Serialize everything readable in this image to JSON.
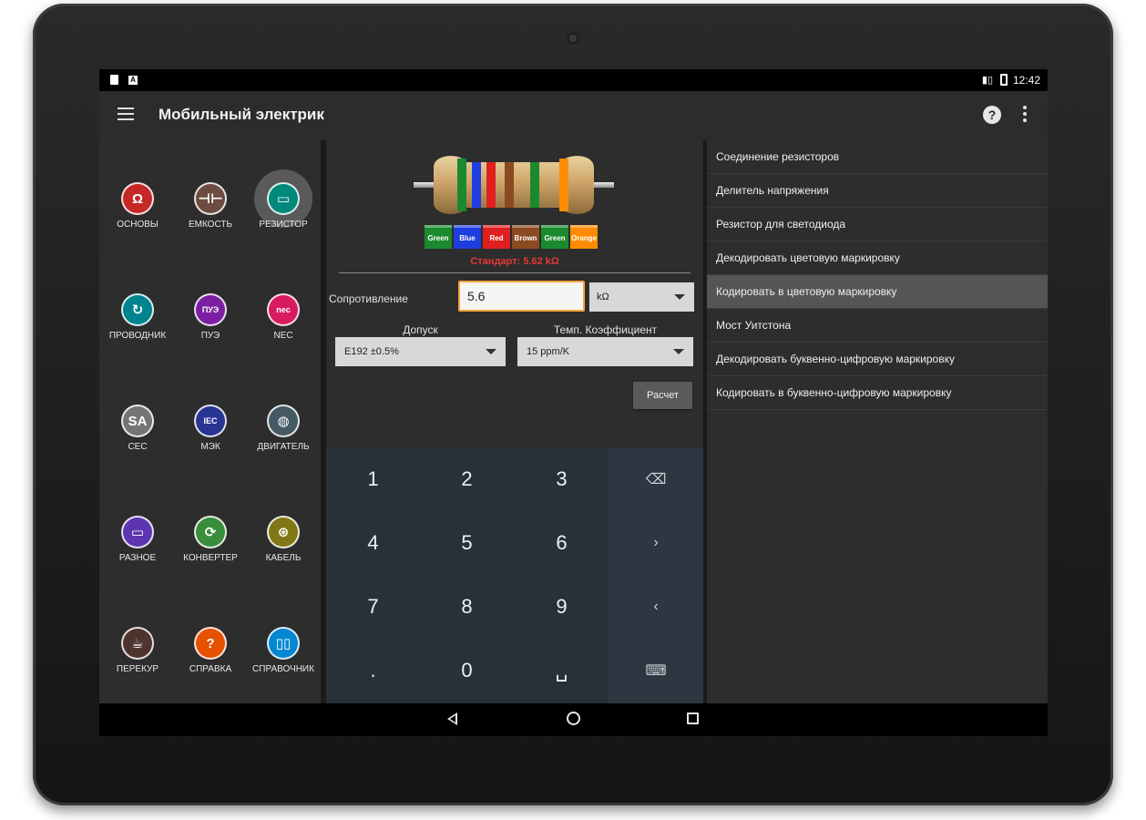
{
  "status_bar": {
    "time": "12:42"
  },
  "toolbar": {
    "title": "Мобильный электрик"
  },
  "left_grid": {
    "items": [
      {
        "label": "ОСНОВЫ",
        "glyph": "Ω",
        "color": "#c62828",
        "icon": "omega-icon"
      },
      {
        "label": "ЕМКОСТЬ",
        "glyph": "⊣⊢",
        "color": "#6d4c41",
        "icon": "capacitor-icon"
      },
      {
        "label": "РЕЗИСТОР",
        "glyph": "▭",
        "color": "#00897b",
        "icon": "resistor-icon"
      },
      {
        "label": "ПРОВОДНИК",
        "glyph": "↻",
        "color": "#00838f",
        "icon": "wire-icon"
      },
      {
        "label": "ПУЭ",
        "glyph": "ПУЭ",
        "color": "#7b1fa2",
        "icon": "pue-icon"
      },
      {
        "label": "NEC",
        "glyph": "nec",
        "color": "#d81b60",
        "icon": "nec-icon"
      },
      {
        "label": "CEC",
        "glyph": "SA",
        "color": "#757575",
        "icon": "cec-icon"
      },
      {
        "label": "МЭК",
        "glyph": "IEC",
        "color": "#283593",
        "icon": "iec-icon"
      },
      {
        "label": "ДВИГАТЕЛЬ",
        "glyph": "◍",
        "color": "#455a64",
        "icon": "motor-icon"
      },
      {
        "label": "РАЗНОЕ",
        "glyph": "▭",
        "color": "#5e35b1",
        "icon": "folder-icon"
      },
      {
        "label": "КОНВЕРТЕР",
        "glyph": "⟳",
        "color": "#388e3c",
        "icon": "converter-icon"
      },
      {
        "label": "КАБЕЛЬ",
        "glyph": "⊛",
        "color": "#827717",
        "icon": "cable-icon"
      },
      {
        "label": "ПЕРЕКУР",
        "glyph": "☕",
        "color": "#4e342e",
        "icon": "coffee-icon"
      },
      {
        "label": "СПРАВКА",
        "glyph": "?",
        "color": "#e65100",
        "icon": "help-circle-icon"
      },
      {
        "label": "СПРАВОЧНИК",
        "glyph": "▯▯",
        "color": "#0288d1",
        "icon": "book-icon"
      }
    ],
    "active_index": 2
  },
  "resistor": {
    "bands": [
      {
        "name": "Green",
        "color": "#1b8a2e"
      },
      {
        "name": "Blue",
        "color": "#1e3ee0"
      },
      {
        "name": "Red",
        "color": "#e02020"
      },
      {
        "name": "Brown",
        "color": "#8b4a22"
      },
      {
        "name": "Green",
        "color": "#1b8a2e"
      },
      {
        "name": "Orange",
        "color": "#ff8c00"
      }
    ],
    "standard_text": "Стандарт:  5.62 kΩ"
  },
  "form": {
    "resistance_label": "Сопротивление",
    "resistance_value": "5.6",
    "unit": "kΩ",
    "tolerance_label": "Допуск",
    "tolerance_value": "E192 ±0.5%",
    "tempco_label": "Темп. Коэффициент",
    "tempco_value": "15 ppm/K",
    "calc_button": "Расчет"
  },
  "keypad": {
    "keys": [
      "1",
      "2",
      "3",
      "4",
      "5",
      "6",
      "7",
      "8",
      "9",
      ".",
      "0",
      "␣"
    ],
    "fn_keys": [
      "⌫",
      "›",
      "‹",
      "⌨"
    ]
  },
  "right_menu": {
    "items": [
      "Соединение резисторов",
      "Делитель напряжения",
      "Резистор для светодиода",
      "Декодировать цветовую маркировку",
      "Кодировать в цветовую маркировку",
      "Мост Уитстона",
      "Декодировать буквенно-цифровую маркировку",
      "Кодировать в буквенно-цифровую маркировку"
    ],
    "selected_index": 4
  }
}
